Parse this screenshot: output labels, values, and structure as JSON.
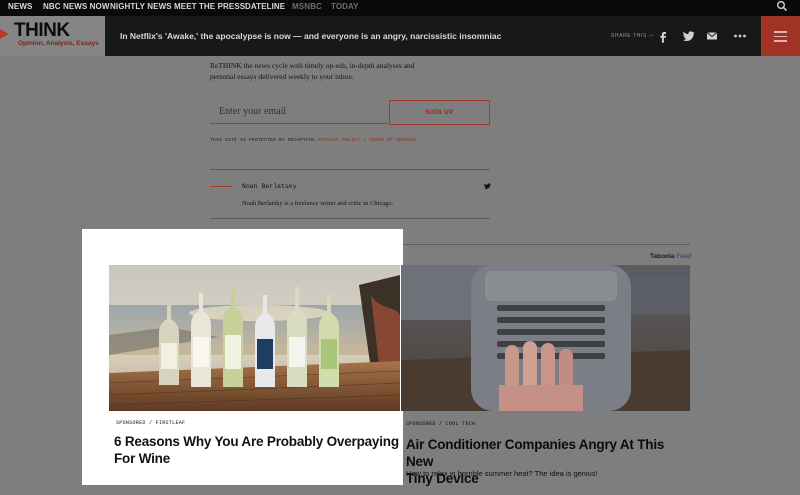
{
  "topnav": {
    "items": [
      {
        "label": "NEWS",
        "dim": false
      },
      {
        "label": "NBC NEWS NOW",
        "dim": false
      },
      {
        "label": "NIGHTLY NEWS",
        "dim": false
      },
      {
        "label": "MEET THE PRESS",
        "dim": false
      },
      {
        "label": "DATELINE",
        "dim": false
      },
      {
        "label": "MSNBC",
        "dim": true
      },
      {
        "label": "TODAY",
        "dim": true
      }
    ],
    "search_icon": "search-icon"
  },
  "header": {
    "logo": "THINK",
    "logo_sub": "Opinion, Analysis, Essays",
    "headline": "In Netflix's 'Awake,' the apocalypse is now — and everyone is an angry, narcissistic insomniac",
    "share_label": "SHARE THIS —",
    "icons": [
      "facebook-icon",
      "twitter-icon",
      "email-icon",
      "more-icon",
      "menu-icon"
    ],
    "accent": "#a13226"
  },
  "newsletter": {
    "description": "ReTHINK the news cycle with timely op-eds, in-depth analyses and personal essays delivered weekly to your inbox.",
    "email_placeholder": "Enter your email",
    "signup_label": "SIGN UP",
    "recaptcha_prefix": "THIS SITE IS PROTECTED BY RECAPTCHA",
    "privacy_label": "PRIVACY POLICY",
    "separator": "|",
    "terms_label": "TERMS OF SERVICE"
  },
  "author": {
    "name": "Noah Berlatsky",
    "bio": "Noah Berlatsky is a freelance writer and critic in Chicago.",
    "twitter_icon": "twitter-icon"
  },
  "taboola": {
    "brand": "Taboola",
    "feed_label": "Feed"
  },
  "cards": [
    {
      "sponsor_label": "SPONSORED",
      "sep": "/",
      "source": "FIRSTLEAF",
      "title_line1": "6 Reasons Why You Are Probably Overpaying",
      "title_line2": "For Wine",
      "description": "",
      "image": "wine-bottles-image"
    },
    {
      "sponsor_label": "SPONSORED",
      "sep": "/",
      "source": "COOL TECH",
      "title_line1": "Air Conditioner Companies Angry At This New",
      "title_line2": "Tiny Device",
      "description": "How to relax in horrible summer heat? The idea is genius!",
      "image": "air-cooler-image"
    }
  ]
}
